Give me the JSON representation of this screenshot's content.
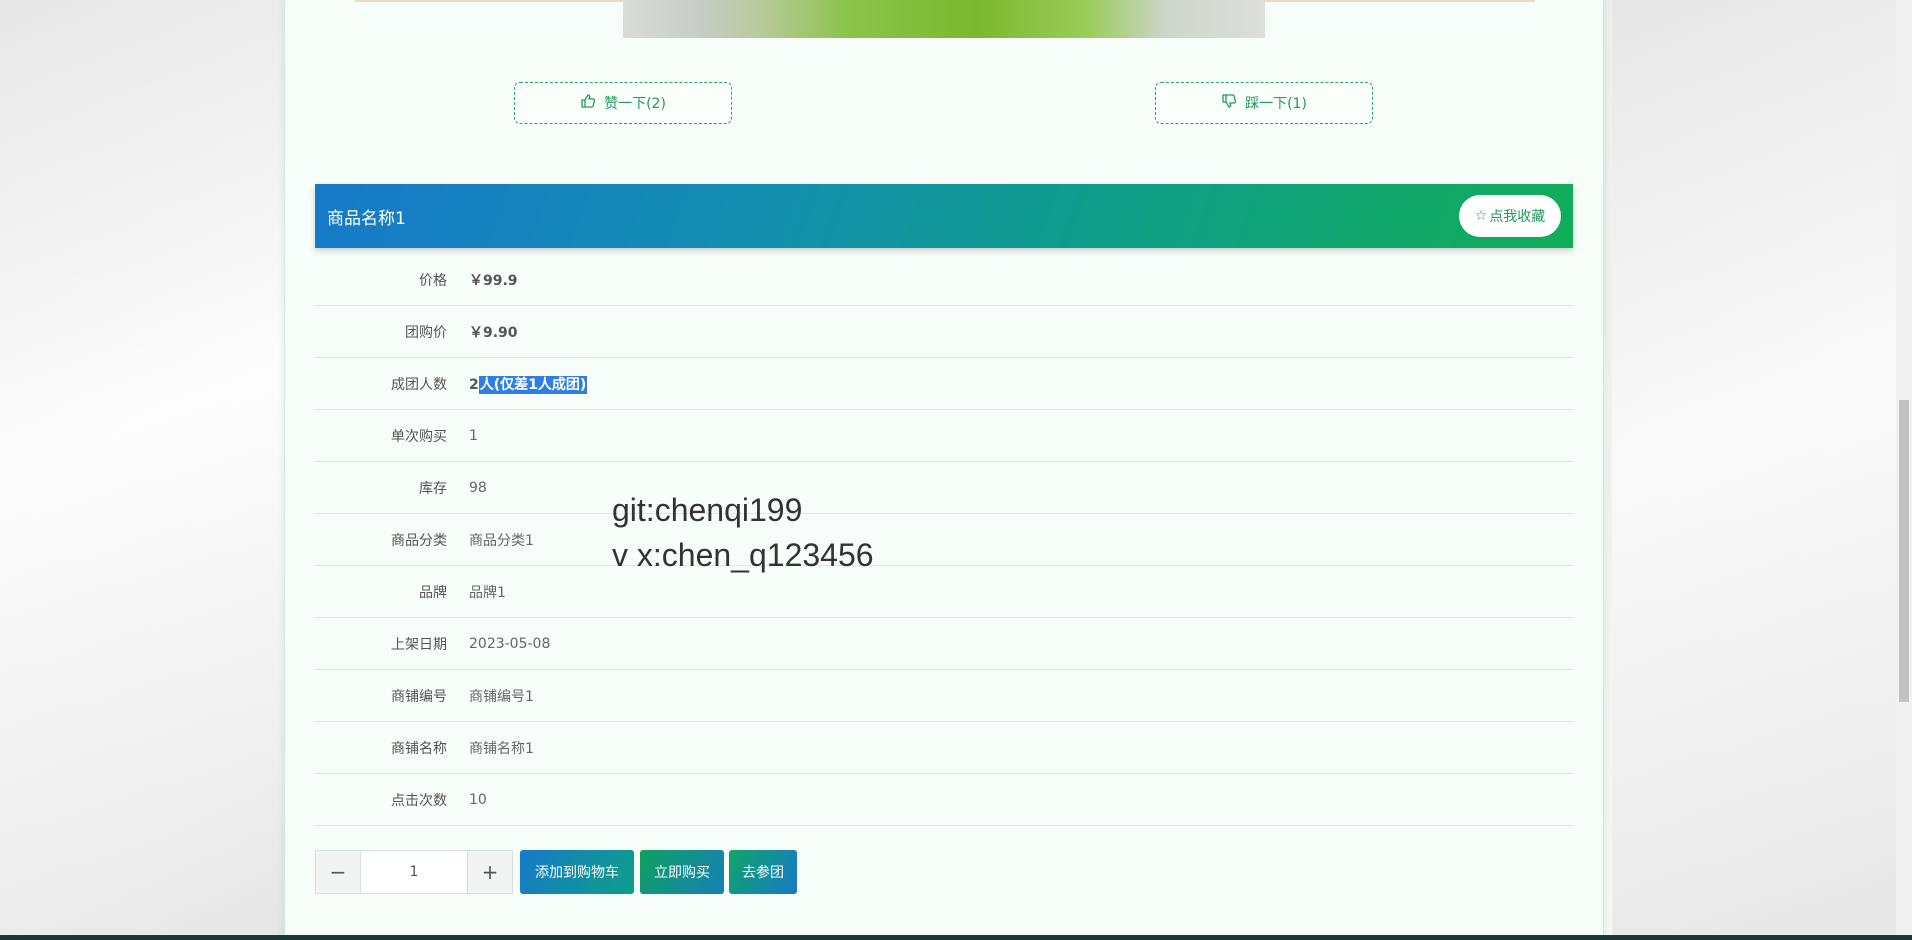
{
  "votes": {
    "like_label": "赞一下(2)",
    "dislike_label": "踩一下(1)"
  },
  "product": {
    "name": "商品名称1",
    "favorite_label": "点我收藏"
  },
  "details": [
    {
      "label": "价格",
      "value": "￥99.9",
      "bold": true
    },
    {
      "label": "团购价",
      "value": "￥9.90",
      "bold": true
    },
    {
      "label": "成团人数",
      "value_prefix": "2",
      "value_selected": "人(仅差1人成团)"
    },
    {
      "label": "单次购买",
      "value": "1"
    },
    {
      "label": "库存",
      "value": "98"
    },
    {
      "label": "商品分类",
      "value": "商品分类1"
    },
    {
      "label": "品牌",
      "value": "品牌1"
    },
    {
      "label": "上架日期",
      "value": "2023-05-08"
    },
    {
      "label": "商铺编号",
      "value": "商铺编号1"
    },
    {
      "label": "商铺名称",
      "value": "商铺名称1"
    },
    {
      "label": "点击次数",
      "value": "10"
    }
  ],
  "watermark": {
    "line1": "git:chenqi199",
    "line2": "v x:chen_q123456"
  },
  "purchase": {
    "quantity": "1",
    "minus": "−",
    "plus": "+",
    "add_to_cart_label": "添加到购物车",
    "buy_now_label": "立即购买",
    "join_group_label": "去参团"
  },
  "colors": {
    "accent_green": "#1f9a60",
    "title_gradient_start": "#1679c9",
    "title_gradient_end": "#10ad58",
    "selection": "#2f7ee3"
  },
  "icons": {
    "like": "thumbs-up-icon",
    "dislike": "thumbs-down-icon",
    "favorite": "star-outline-icon"
  }
}
